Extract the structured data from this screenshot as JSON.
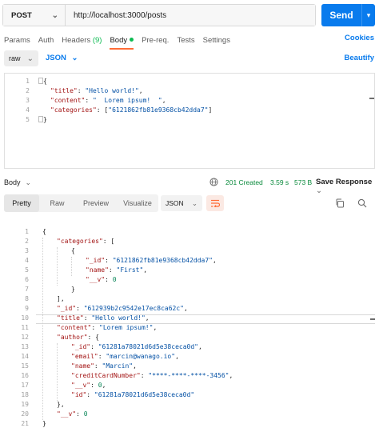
{
  "request": {
    "method": "POST",
    "url": "http://localhost:3000/posts",
    "send_label": "Send"
  },
  "req_tabs": [
    {
      "label": "Params"
    },
    {
      "label": "Auth"
    },
    {
      "label": "Headers",
      "count": "(9)"
    },
    {
      "label": "Body"
    },
    {
      "label": "Pre-req."
    },
    {
      "label": "Tests"
    },
    {
      "label": "Settings"
    }
  ],
  "cookies_label": "Cookies",
  "body_format": {
    "mode": "raw",
    "language": "JSON",
    "beautify_label": "Beautify"
  },
  "request_body": {
    "line_numbers": [
      "1",
      "2",
      "3",
      "4",
      "5"
    ],
    "lines": [
      {
        "open": "{"
      },
      {
        "key": "\"title\"",
        "sep": ": ",
        "val": "\"Hello world!\"",
        "end": ","
      },
      {
        "key": "\"content\"",
        "sep": ": ",
        "val": "\"  Lorem ipsum!  \"",
        "end": ","
      },
      {
        "key": "\"categories\"",
        "sep": ": [",
        "val": "\"6121862fb81e9368cb42dda7\"",
        "end": "]"
      },
      {
        "open": "}"
      }
    ]
  },
  "response": {
    "title": "Body",
    "status": "201 Created",
    "time": "3.59 s",
    "size": "573 B",
    "save_label": "Save Response",
    "tabs": [
      "Pretty",
      "Raw",
      "Preview",
      "Visualize"
    ],
    "format": "JSON"
  },
  "response_body": {
    "line_numbers": [
      "1",
      "2",
      "3",
      "4",
      "5",
      "6",
      "7",
      "8",
      "9",
      "10",
      "11",
      "12",
      "13",
      "14",
      "15",
      "16",
      "17",
      "18",
      "19",
      "20",
      "21"
    ],
    "lines": [
      {
        "text": "{",
        "indent": 0
      },
      {
        "key": "\"categories\"",
        "sep": ": [",
        "indent": 1
      },
      {
        "text": "{",
        "indent": 2
      },
      {
        "key": "\"_id\"",
        "sep": ": ",
        "val": "\"6121862fb81e9368cb42dda7\"",
        "end": ",",
        "indent": 3
      },
      {
        "key": "\"name\"",
        "sep": ": ",
        "val": "\"First\"",
        "end": ",",
        "indent": 3
      },
      {
        "key": "\"__v\"",
        "sep": ": ",
        "num": "0",
        "indent": 3
      },
      {
        "text": "}",
        "indent": 2
      },
      {
        "text": "],",
        "indent": 1
      },
      {
        "key": "\"_id\"",
        "sep": ": ",
        "val": "\"612939b2c9542e17ec8ca62c\"",
        "end": ",",
        "indent": 1
      },
      {
        "key": "\"title\"",
        "sep": ": ",
        "val": "\"Hello world!\"",
        "end": ",",
        "indent": 1
      },
      {
        "key": "\"content\"",
        "sep": ": ",
        "val": "\"Lorem ipsum!\"",
        "end": ",",
        "indent": 1
      },
      {
        "key": "\"author\"",
        "sep": ": {",
        "indent": 1
      },
      {
        "key": "\"_id\"",
        "sep": ": ",
        "val": "\"61281a78021d6d5e38ceca0d\"",
        "end": ",",
        "indent": 2
      },
      {
        "key": "\"email\"",
        "sep": ": ",
        "val": "\"marcin@wanago.io\"",
        "end": ",",
        "indent": 2
      },
      {
        "key": "\"name\"",
        "sep": ": ",
        "val": "\"Marcin\"",
        "end": ",",
        "indent": 2
      },
      {
        "key": "\"creditCardNumber\"",
        "sep": ": ",
        "val": "\"****-****-****-3456\"",
        "end": ",",
        "indent": 2
      },
      {
        "key": "\"__v\"",
        "sep": ": ",
        "num": "0",
        "end": ",",
        "indent": 2
      },
      {
        "key": "\"id\"",
        "sep": ": ",
        "val": "\"61281a78021d6d5e38ceca0d\"",
        "indent": 2
      },
      {
        "text": "},",
        "indent": 1
      },
      {
        "key": "\"__v\"",
        "sep": ": ",
        "num": "0",
        "indent": 1
      },
      {
        "text": "}",
        "indent": 0
      }
    ]
  }
}
